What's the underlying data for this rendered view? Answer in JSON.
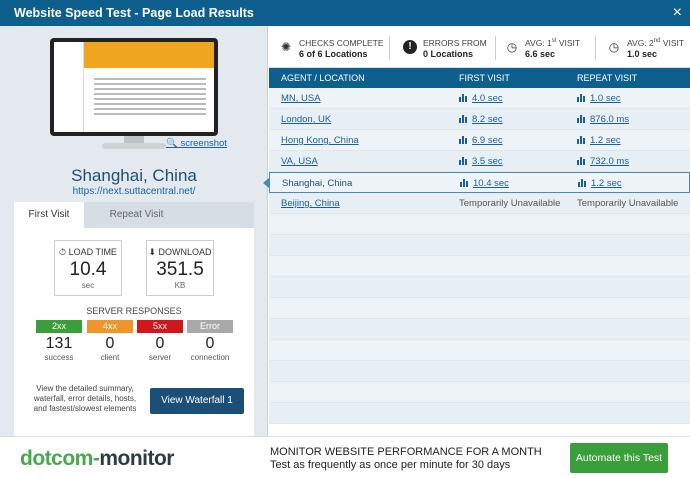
{
  "window": {
    "title": "Website Speed Test - Page Load Results",
    "close_label": "×"
  },
  "left": {
    "screenshot_label": "screenshot",
    "location": "Shanghai, China",
    "url": "https://next.suttacentral.net/",
    "tabs": [
      "First Visit",
      "Repeat Visit"
    ],
    "load_time": {
      "label": "LOAD TIME",
      "value": "10.4",
      "unit": "sec"
    },
    "download": {
      "label": "DOWNLOAD",
      "value": "351.5",
      "unit": "KB"
    },
    "server_title": "SERVER RESPONSES",
    "responses": [
      {
        "code": "2xx",
        "count": "131",
        "caption": "success",
        "color": "#3a9e3a"
      },
      {
        "code": "4xx",
        "count": "0",
        "caption": "client",
        "color": "#f0952a"
      },
      {
        "code": "5xx",
        "count": "0",
        "caption": "server",
        "color": "#d0171c"
      },
      {
        "code": "Error",
        "count": "0",
        "caption": "connection",
        "color": "#a9a9a9"
      }
    ],
    "help_text": "View the detailed summary, waterfall, error details, hosts, and fastest/slowest elements",
    "waterfall_button": "View Waterfall 1"
  },
  "stats": {
    "checks": {
      "label": "CHECKS COMPLETE",
      "value": "6 of 6 Locations"
    },
    "errors": {
      "label": "ERRORS FROM",
      "value": "0 Locations"
    },
    "avg_first": {
      "label_prefix": "AVG: 1",
      "sup": "st",
      "label_suffix": " VISIT",
      "value": "6.6 sec"
    },
    "avg_second": {
      "label_prefix": "AVG: 2",
      "sup": "nd",
      "label_suffix": " VISIT",
      "value": "1.0 sec"
    }
  },
  "table": {
    "headers": [
      "AGENT / LOCATION",
      "FIRST VISIT",
      "REPEAT VISIT"
    ],
    "rows": [
      {
        "location": "MN, USA",
        "first": "4.0 sec",
        "repeat": "1.0 sec"
      },
      {
        "location": "London, UK",
        "first": "8.2 sec",
        "repeat": "876.0 ms"
      },
      {
        "location": "Hong Kong, China",
        "first": "6.9 sec",
        "repeat": "1.2 sec"
      },
      {
        "location": "VA, USA",
        "first": "3.5 sec",
        "repeat": "732.0 ms"
      },
      {
        "location": "Shanghai, China",
        "first": "10.4 sec",
        "repeat": "1.2 sec"
      },
      {
        "location": "Beijing, China",
        "first": "Temporarily Unavailable",
        "repeat": "Temporarily Unavailable"
      }
    ]
  },
  "footer": {
    "logo_a": "dotcom-",
    "logo_b": "monitor",
    "promo_line1": "MONITOR WEBSITE PERFORMANCE FOR A MONTH",
    "promo_line2": "Test as frequently as once per minute for 30 days",
    "button": "Automate this Test"
  }
}
